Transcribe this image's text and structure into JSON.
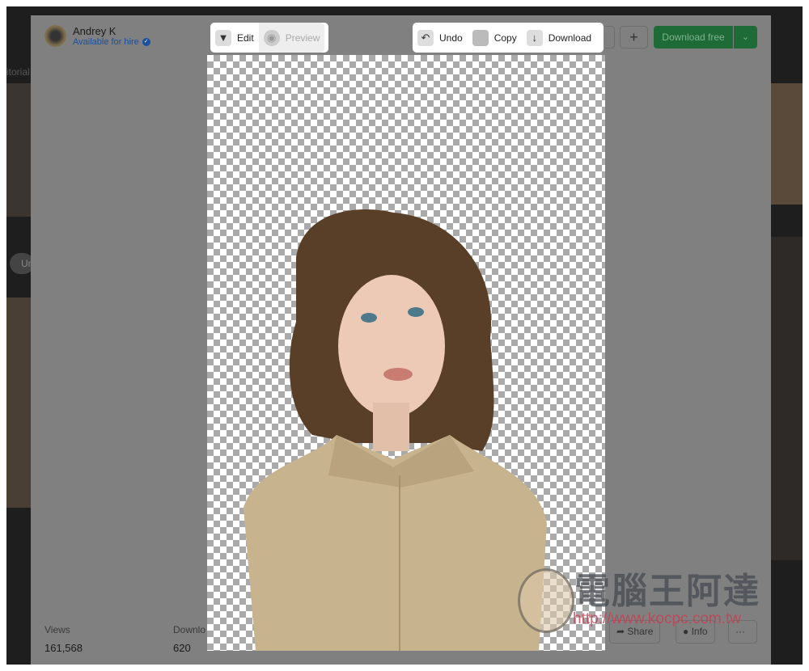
{
  "background": {
    "left_text": "itorial",
    "pill": "Un"
  },
  "author": {
    "name": "Andrey K",
    "status": "Available for hire"
  },
  "edit_toolbar": {
    "edit": "Edit",
    "preview": "Preview"
  },
  "action_toolbar": {
    "undo": "Undo",
    "copy": "Copy",
    "download": "Download"
  },
  "header": {
    "add": "+",
    "download_free": "Download free",
    "dropdown": "⌄"
  },
  "stats": {
    "views_label": "Views",
    "views": "161,568",
    "downloads_label": "Downlo",
    "downloads": "620"
  },
  "actions": {
    "share": "Share",
    "info": "Info",
    "more": "···"
  },
  "watermark": {
    "title": "電腦王阿達",
    "url": "http://www.kocpc.com.tw"
  },
  "colors": {
    "accent": "#1e6b38",
    "link": "#1b4f9a"
  }
}
